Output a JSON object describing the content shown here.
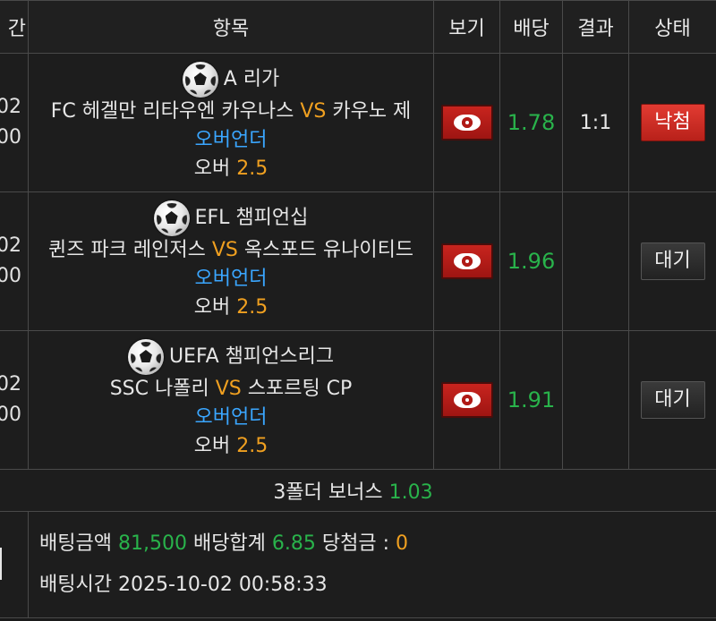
{
  "header": {
    "col_date": "간",
    "col_item": "항목",
    "col_view": "보기",
    "col_odds": "배당",
    "col_result": "결과",
    "col_status": "상태"
  },
  "bets": [
    {
      "date_line1": "02",
      "date_line2": "00",
      "league": "A 리가",
      "home": "FC 헤겔만 리타우엔 카우나스",
      "vs": "VS",
      "away": "카우노 제",
      "market": "오버언더",
      "pick_label": "오버",
      "pick_value": "2.5",
      "odds": "1.78",
      "result": "1:1",
      "status": "낙첨",
      "status_type": "win"
    },
    {
      "date_line1": "02",
      "date_line2": "00",
      "league": "EFL 챔피언십",
      "home": "퀸즈 파크 레인저스",
      "vs": "VS",
      "away": "옥스포드 유나이티드",
      "market": "오버언더",
      "pick_label": "오버",
      "pick_value": "2.5",
      "odds": "1.96",
      "result": "",
      "status": "대기",
      "status_type": "wait"
    },
    {
      "date_line1": "02",
      "date_line2": "00",
      "league": "UEFA 챔피언스리그",
      "home": "SSC 나폴리",
      "vs": "VS",
      "away": "스포르팅 CP",
      "market": "오버언더",
      "pick_label": "오버",
      "pick_value": "2.5",
      "odds": "1.91",
      "result": "",
      "status": "대기",
      "status_type": "wait"
    }
  ],
  "bonus": {
    "label": "3폴더 보너스",
    "value": "1.03"
  },
  "summary": {
    "bet_amount_label": "배팅금액",
    "bet_amount": "81,500",
    "odds_total_label": "배당합계",
    "odds_total": "6.85",
    "payout_label": "당첨금 :",
    "payout": "0",
    "bet_time_label": "배팅시간",
    "bet_time": "2025-10-02 00:58:33"
  },
  "colors": {
    "odds_green": "#29b34b",
    "accent_orange": "#f0a020",
    "market_blue": "#3aa6ff",
    "lose_red": "#d22a22"
  }
}
